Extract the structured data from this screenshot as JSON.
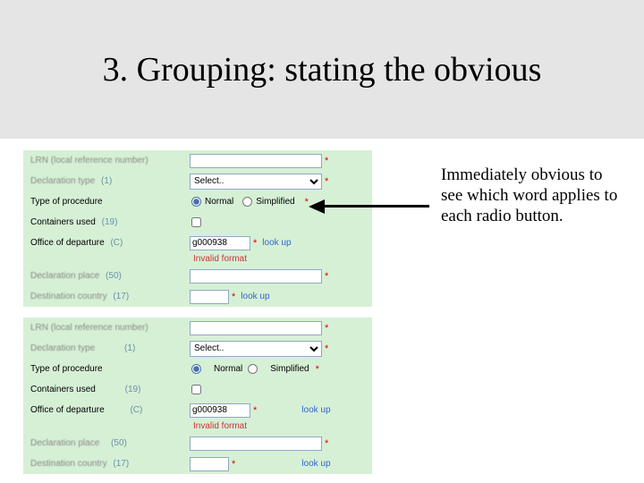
{
  "slide": {
    "title": "3. Grouping: stating the obvious",
    "annotation": "Immediately obvious to see which word applies to each radio button."
  },
  "formA": {
    "lrn_label": "LRN (local reference number)",
    "decl_type_label": "Declaration type",
    "decl_type_hint": "(1)",
    "decl_type_value": "Select..",
    "proc_label": "Type of procedure",
    "proc_opt1": "Normal",
    "proc_opt2": "Simplified",
    "containers_label": "Containers used",
    "containers_hint": "(19)",
    "office_label": "Office of departure",
    "office_hint": "(C)",
    "office_value": "g000938",
    "lookup": "look up",
    "error": "Invalid format",
    "place_label": "Declaration place",
    "place_hint": "(50)",
    "dest_label": "Destination country",
    "dest_hint": "(17)"
  },
  "formB": {
    "lrn_label": "LRN (local reference number)",
    "decl_type_label": "Declaration type",
    "decl_type_hint": "(1)",
    "decl_type_value": "Select..",
    "proc_label": "Type of procedure",
    "proc_opt1": "Normal",
    "proc_opt2": "Simplified",
    "containers_label": "Containers used",
    "containers_hint": "(19)",
    "office_label": "Office of departure",
    "office_hint": "(C)",
    "office_value": "g000938",
    "lookup": "look up",
    "error": "Invalid format",
    "place_label": "Declaration place",
    "place_hint": "(50)",
    "dest_label": "Destination country",
    "dest_hint": "(17)"
  },
  "asterisk": "*"
}
